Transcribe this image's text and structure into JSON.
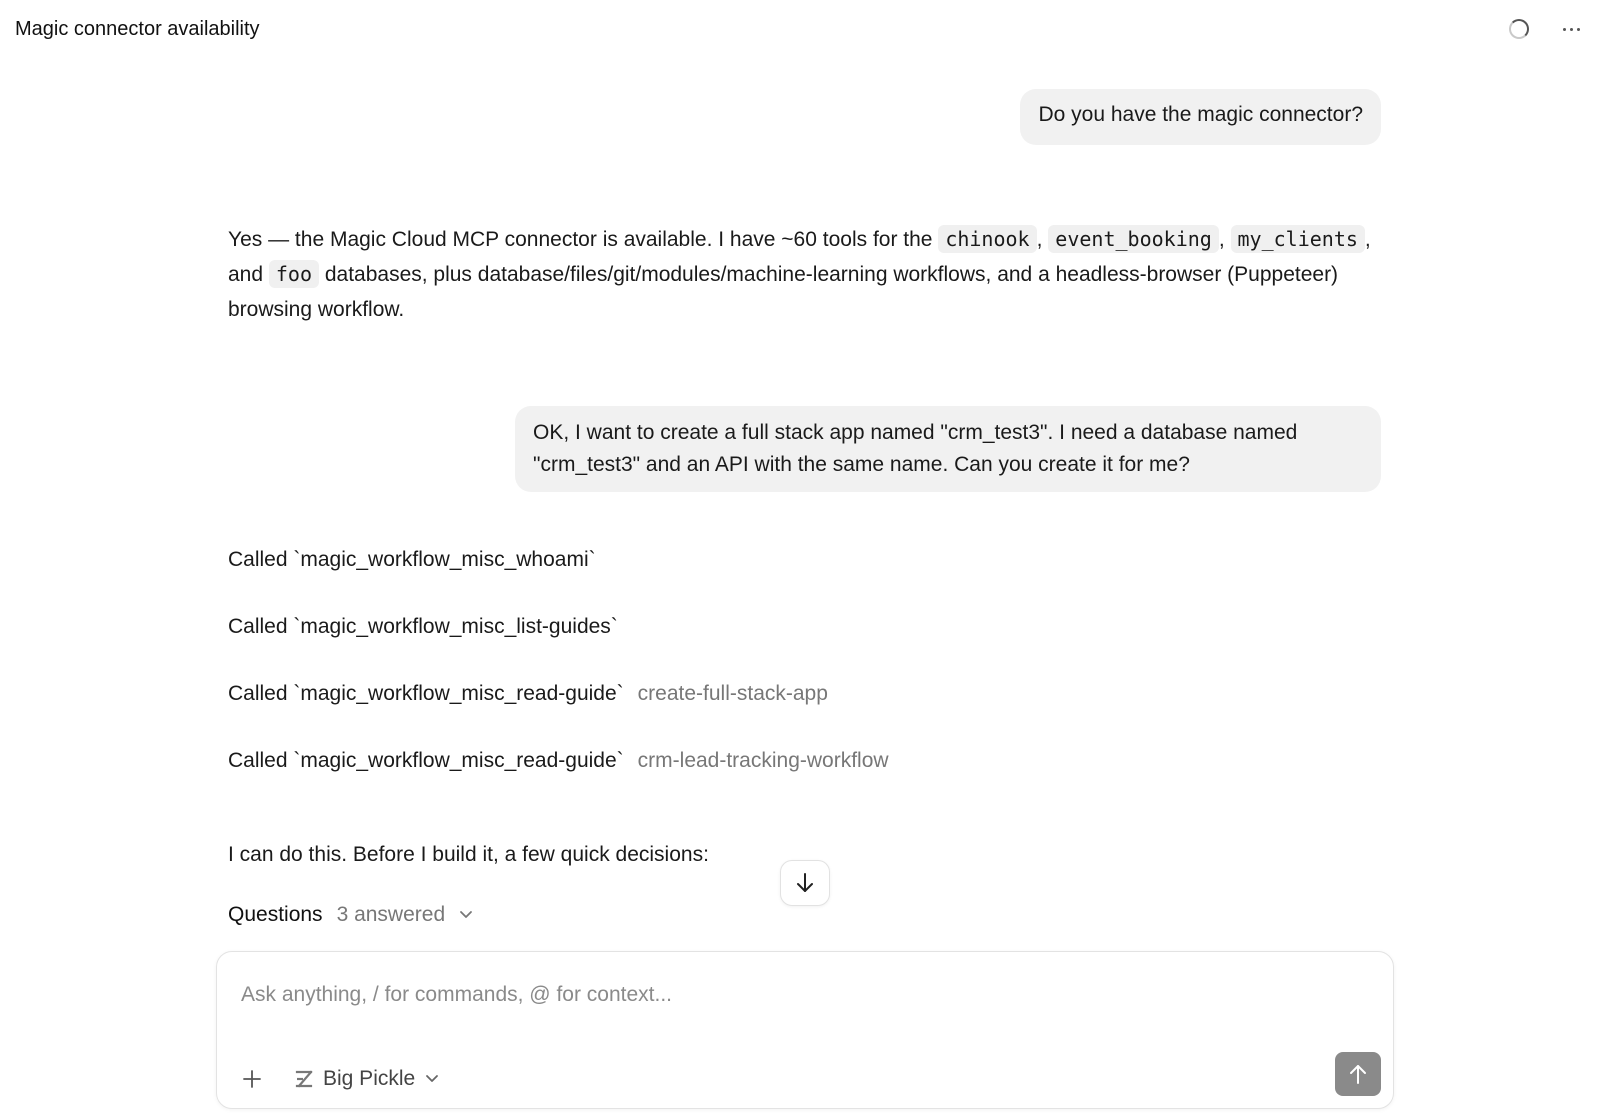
{
  "header": {
    "title": "Magic connector availability"
  },
  "messages": {
    "user_1": "Do you have the magic connector?",
    "assistant_1": {
      "part_a": "Yes — the Magic Cloud MCP connector is available. I have ~60 tools for the ",
      "code_1": "chinook",
      "sep_1": ", ",
      "code_2": "event_booking",
      "sep_2": ", ",
      "code_3": "my_clients",
      "sep_3": ", and ",
      "code_4": "foo",
      "part_b": " databases, plus database/files/git/modules/machine-learning workflows, and a headless-browser (Puppeteer) browsing workflow."
    },
    "user_2": "OK, I want to create a full stack app named \"crm_test3\". I need a database named \"crm_test3\" and an API with the same name. Can you create it for me?"
  },
  "tool_calls": [
    {
      "label": "Called `magic_workflow_misc_whoami`",
      "arg": ""
    },
    {
      "label": "Called `magic_workflow_misc_list-guides`",
      "arg": ""
    },
    {
      "label": "Called `magic_workflow_misc_read-guide`",
      "arg": "create-full-stack-app"
    },
    {
      "label": "Called `magic_workflow_misc_read-guide`",
      "arg": "crm-lead-tracking-workflow"
    }
  ],
  "assistant_2": "I can do this. Before I build it, a few quick decisions:",
  "questions": {
    "label": "Questions",
    "count": "3 answered"
  },
  "composer": {
    "placeholder": "Ask anything, / for commands, @ for context...",
    "model": "Big Pickle"
  },
  "icons": {
    "spinner": "loading-spinner-icon",
    "more": "more-horizontal-icon",
    "scroll": "arrow-down-icon",
    "chevron": "chevron-down-icon",
    "plus": "plus-icon",
    "model": "model-logo-icon",
    "send": "arrow-up-icon"
  }
}
